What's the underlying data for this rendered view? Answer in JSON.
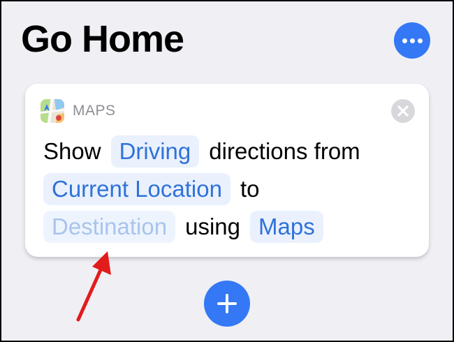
{
  "shortcut": {
    "title": "Go Home"
  },
  "action": {
    "app_name": "MAPS",
    "line1": {
      "w1": "Show",
      "t1": "Driving",
      "w2": "directions from"
    },
    "line2": {
      "t1": "Current Location",
      "w1": "to"
    },
    "line3": {
      "t1": "Destination",
      "w1": "using",
      "t2": "Maps"
    }
  },
  "icons": {
    "more": "ellipsis-icon",
    "close": "close-x-icon",
    "add": "plus-icon",
    "app": "maps-app-icon",
    "annotation": "red-arrow"
  },
  "colors": {
    "accent": "#3478f6",
    "token_text": "#2f72d8",
    "token_bg": "#eaf1fd",
    "placeholder_text": "#a9c4ec",
    "annotation": "#e21b1b"
  }
}
